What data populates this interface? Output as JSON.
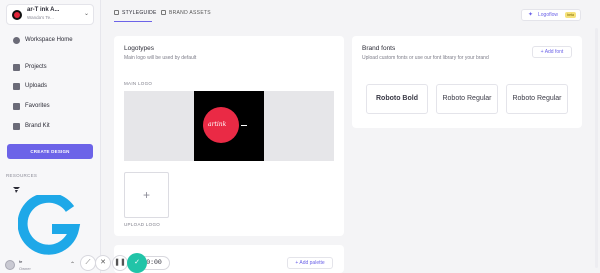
{
  "workspace": {
    "name": "ar-T ink A...",
    "subtitle": "Wanda's Te..."
  },
  "sidebar": {
    "items": [
      {
        "label": "Workspace Home",
        "icon": "home-icon"
      },
      {
        "label": "Projects",
        "icon": "folder-icon"
      },
      {
        "label": "Uploads",
        "icon": "upload-folder-icon"
      },
      {
        "label": "Favorites",
        "icon": "star-folder-icon"
      },
      {
        "label": "Brand Kit",
        "icon": "brand-kit-icon"
      }
    ],
    "create_label": "CREATE DESIGN",
    "resources_title": "RESOURCES"
  },
  "user": {
    "name": "fe",
    "subtitle": "Owner"
  },
  "tabs": [
    {
      "label": "STYLEGUIDE",
      "active": true
    },
    {
      "label": "BRAND ASSETS",
      "active": false
    }
  ],
  "logoflow": {
    "label": "Logoflow",
    "badge": "beta"
  },
  "logotypes": {
    "title": "Logotypes",
    "subtitle": "Main logo will be used by default",
    "main_label": "MAIN LOGO",
    "upload_label": "UPLOAD LOGO"
  },
  "brand_fonts": {
    "title": "Brand fonts",
    "subtitle": "Upload custom fonts or use our font library for your brand",
    "add_label": "+ Add font",
    "fonts": [
      "Roboto Bold",
      "Roboto Regular",
      "Roboto Regular"
    ]
  },
  "palette": {
    "add_label": "+ Add palette"
  },
  "recorder": {
    "time": "0:00"
  },
  "colors": {
    "accent": "#6c63e8",
    "logo_red": "#ea2a45",
    "teal": "#21c4a8"
  }
}
